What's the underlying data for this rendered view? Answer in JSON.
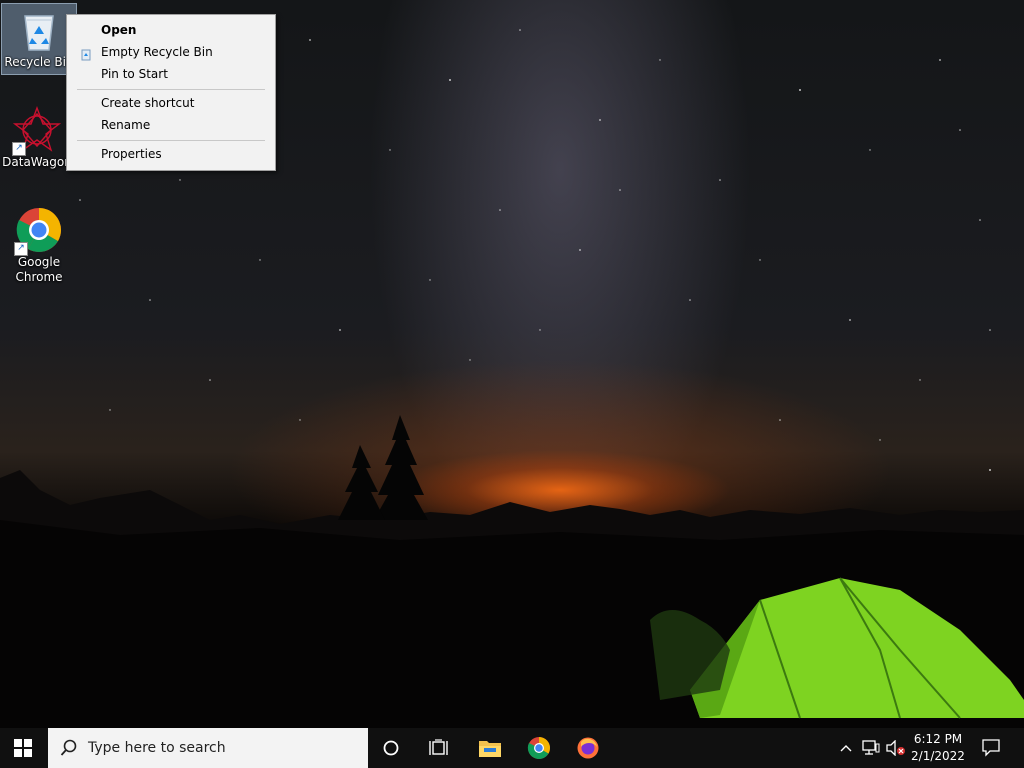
{
  "desktop": {
    "icons": [
      {
        "label": "Recycle Bin"
      },
      {
        "label": "DataWagon"
      },
      {
        "label": "Google Chrome"
      }
    ]
  },
  "context_menu": {
    "items": [
      {
        "label": "Open"
      },
      {
        "label": "Empty Recycle Bin"
      },
      {
        "label": "Pin to Start"
      },
      {
        "label": "Create shortcut"
      },
      {
        "label": "Rename"
      },
      {
        "label": "Properties"
      }
    ]
  },
  "taskbar": {
    "search_placeholder": "Type here to search",
    "pinned_icons": [
      "windows-start-icon",
      "cortana-icon",
      "task-view-icon",
      "file-explorer-icon",
      "chrome-icon",
      "firefox-icon"
    ],
    "tray_icons": [
      "chevron-up-icon",
      "network-icon",
      "volume-muted-icon"
    ],
    "clock": {
      "time": "6:12 PM",
      "date": "2/1/2022"
    }
  }
}
